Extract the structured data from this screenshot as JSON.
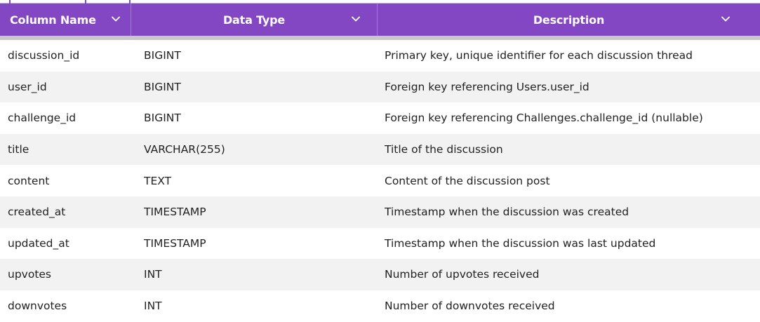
{
  "table": {
    "columns": [
      {
        "label": "Column Name"
      },
      {
        "label": "Data Type"
      },
      {
        "label": "Description"
      }
    ],
    "rows": [
      {
        "name": "discussion_id",
        "type": "BIGINT",
        "description": "Primary key, unique identifier for each discussion thread"
      },
      {
        "name": "user_id",
        "type": "BIGINT",
        "description": "Foreign key referencing Users.user_id"
      },
      {
        "name": "challenge_id",
        "type": "BIGINT",
        "description": "Foreign key referencing Challenges.challenge_id (nullable)"
      },
      {
        "name": "title",
        "type": "VARCHAR(255)",
        "description": "Title of the discussion"
      },
      {
        "name": "content",
        "type": "TEXT",
        "description": "Content of the discussion post"
      },
      {
        "name": "created_at",
        "type": "TIMESTAMP",
        "description": "Timestamp when the discussion was created"
      },
      {
        "name": "updated_at",
        "type": "TIMESTAMP",
        "description": "Timestamp when the discussion was last updated"
      },
      {
        "name": "upvotes",
        "type": "INT",
        "description": "Number of upvotes received"
      },
      {
        "name": "downvotes",
        "type": "INT",
        "description": "Number of downvotes received"
      }
    ]
  },
  "icons": {
    "sort": "chevron-down-icon"
  },
  "colors": {
    "header_bg": "#8347c3",
    "header_text": "#ffffff",
    "row_alt": "#f2f2f2"
  }
}
